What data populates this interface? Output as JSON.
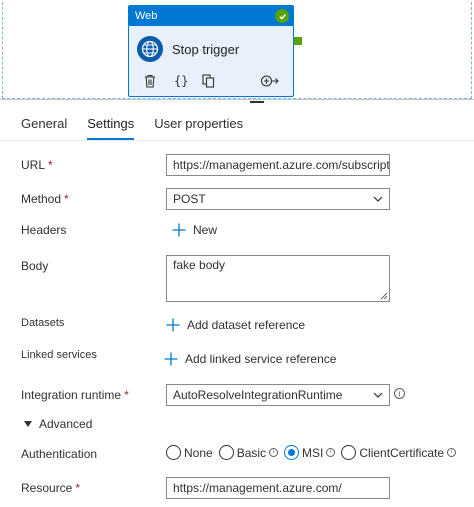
{
  "canvas": {
    "activity": {
      "type_label": "Web",
      "name": "Stop trigger",
      "actions": {
        "delete_icon": "trash-icon",
        "code_icon": "code-braces-icon",
        "copy_icon": "copy-icon",
        "add_output_icon": "add-output-icon",
        "braces_text": "{}"
      },
      "status_icon": "success-check-icon"
    }
  },
  "tabs": [
    {
      "label": "General",
      "active": false
    },
    {
      "label": "Settings",
      "active": true
    },
    {
      "label": "User properties",
      "active": false
    }
  ],
  "form": {
    "url": {
      "label": "URL",
      "required": "*",
      "value": "https://management.azure.com/subscriptio"
    },
    "method": {
      "label": "Method",
      "required": "*",
      "value": "POST"
    },
    "headers": {
      "label": "Headers",
      "new_label": "New"
    },
    "body": {
      "label": "Body",
      "value": "fake body"
    },
    "datasets": {
      "label": "Datasets",
      "add_label": "Add dataset reference"
    },
    "linked_services": {
      "label": "Linked services",
      "add_label": "Add linked service reference"
    },
    "integration_runtime": {
      "label": "Integration runtime",
      "required": "*",
      "value": "AutoResolveIntegrationRuntime",
      "info": "i"
    },
    "advanced": {
      "label": "Advanced",
      "expanded": true
    },
    "authentication": {
      "label": "Authentication",
      "options": [
        {
          "label": "None",
          "checked": false,
          "info": ""
        },
        {
          "label": "Basic",
          "checked": false,
          "info": "i"
        },
        {
          "label": "MSI",
          "checked": true,
          "info": "i"
        },
        {
          "label": "ClientCertificate",
          "checked": false,
          "info": "i"
        }
      ]
    },
    "resource": {
      "label": "Resource",
      "required": "*",
      "value": "https://management.azure.com/"
    }
  },
  "colors": {
    "accent": "#0078d4",
    "success": "#57a300",
    "required": "#a4262c"
  }
}
